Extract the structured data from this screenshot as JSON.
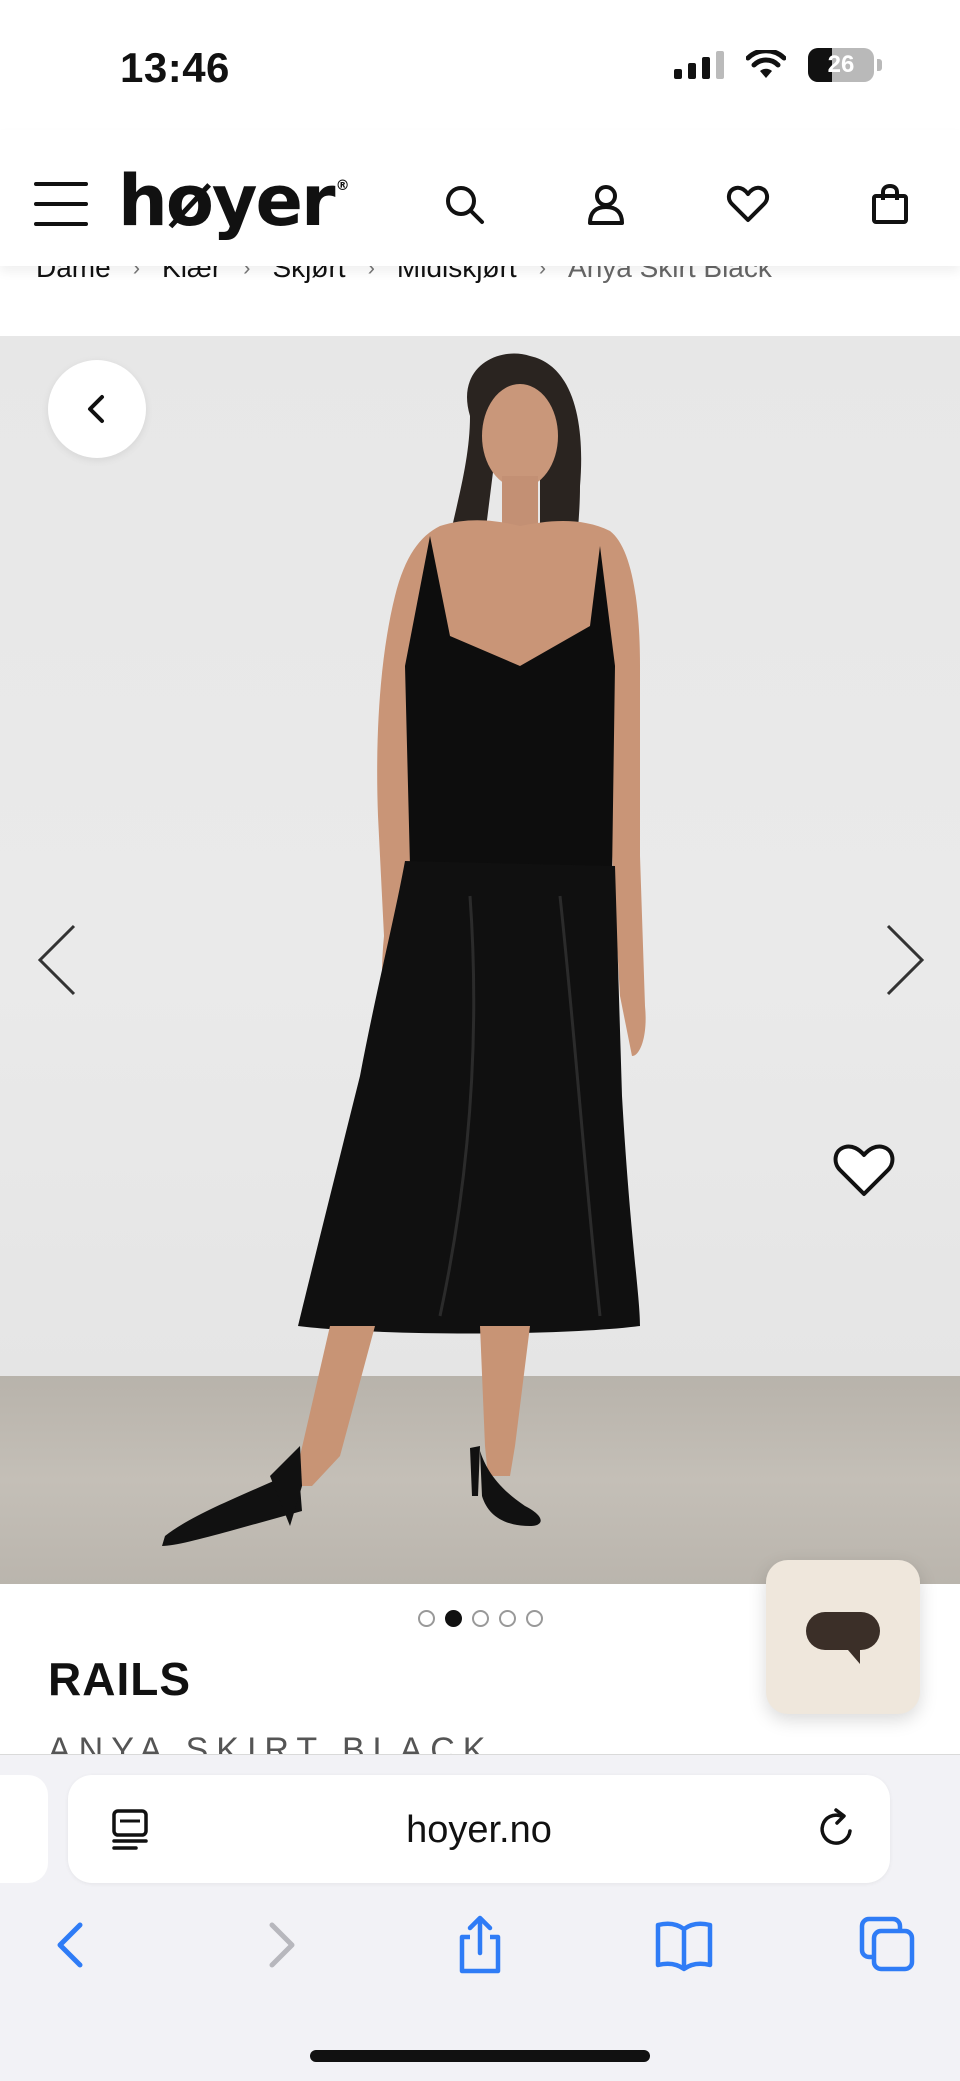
{
  "status_bar": {
    "time": "13:46",
    "battery": "26",
    "icons": [
      "cellular-signal-icon",
      "wifi-icon",
      "battery-icon"
    ]
  },
  "header": {
    "logo": "høyer",
    "logo_mark": "®",
    "icons": [
      "menu-icon",
      "search-icon",
      "account-icon",
      "wishlist-icon",
      "shopping-bag-icon"
    ]
  },
  "breadcrumb": {
    "items": [
      "Dame",
      "Klær",
      "Skjørt",
      "Midiskjørt"
    ],
    "current": "Anya Skirt Black",
    "separator": "›"
  },
  "gallery": {
    "image_alt": "Model wearing black satin cami and midi skirt",
    "total_images": 5,
    "active_index": 2,
    "icons": [
      "back-icon",
      "chevron-left-icon",
      "chevron-right-icon",
      "heart-icon"
    ]
  },
  "product": {
    "brand": "RAILS",
    "name": "ANYA SKIRT BLACK"
  },
  "chat": {
    "icon": "chat-bubble-icon"
  },
  "browser": {
    "url": "hoyer.no",
    "toolbar_icons": [
      "back-icon",
      "forward-icon",
      "share-icon",
      "bookmarks-icon",
      "tabs-icon"
    ],
    "accent": "#2f7cf6"
  }
}
